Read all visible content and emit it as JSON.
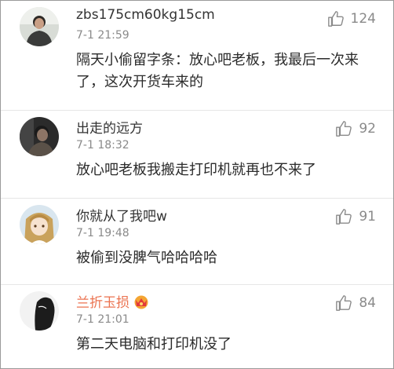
{
  "comments": [
    {
      "username": "zbs175cm60kg15cm",
      "time": "7-1 21:59",
      "likes": "124",
      "text": "隔天小偷留字条：放心吧老板，我最后一次来了，这次开货车来的"
    },
    {
      "username": "出走的远方",
      "time": "7-1 18:32",
      "likes": "92",
      "text": "放心吧老板我搬走打印机就再也不来了"
    },
    {
      "username": "你就从了我吧w",
      "time": "7-1 19:48",
      "likes": "91",
      "text": "被偷到没脾气哈哈哈哈"
    },
    {
      "username": "兰折玉损",
      "time": "7-1 21:01",
      "likes": "84",
      "text": "第二天电脑和打印机没了"
    }
  ]
}
